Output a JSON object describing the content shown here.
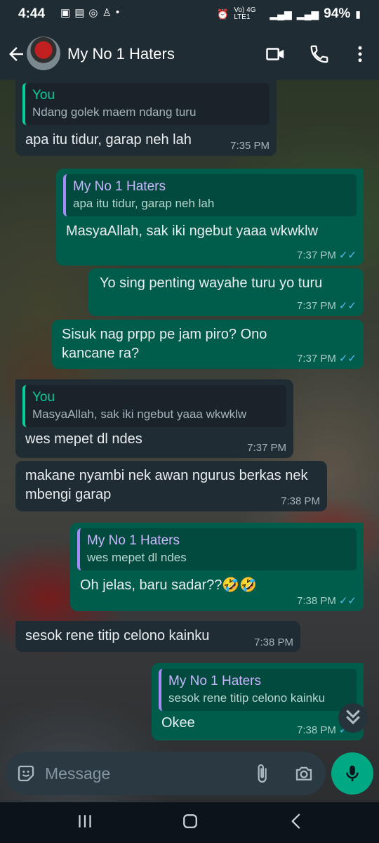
{
  "status_bar": {
    "time": "4:44",
    "network": "Vo) 4G LTE1",
    "battery": "94%"
  },
  "header": {
    "title": "My No 1 Haters"
  },
  "messages": [
    {
      "dir": "in",
      "quote_author": "You",
      "quote_text": "Ndang golek maem ndang turu",
      "text": "apa itu tidur, garap neh lah",
      "time": "7:35 PM"
    },
    {
      "dir": "out",
      "quote_author": "My No 1 Haters",
      "quote_text": "apa itu tidur, garap neh lah",
      "text": "MasyaAllah, sak iki ngebut yaaa wkwklw",
      "time": "7:37 PM"
    },
    {
      "dir": "out",
      "text": "Yo sing penting wayahe turu yo turu",
      "time": "7:37 PM"
    },
    {
      "dir": "out",
      "text": "Sisuk nag prpp pe jam piro? Ono kancane ra?",
      "time": "7:37 PM"
    },
    {
      "dir": "in",
      "quote_author": "You",
      "quote_text": "MasyaAllah, sak iki ngebut yaaa wkwklw",
      "text": "wes mepet dl ndes",
      "time": "7:37 PM"
    },
    {
      "dir": "in",
      "text": "makane nyambi nek awan ngurus berkas nek mbengi garap",
      "time": "7:38 PM"
    },
    {
      "dir": "out",
      "quote_author": "My No 1 Haters",
      "quote_text": "wes mepet dl ndes",
      "text": "Oh jelas, baru sadar??🤣🤣",
      "time": "7:38 PM"
    },
    {
      "dir": "in",
      "text": "sesok rene titip celono kainku",
      "time": "7:38 PM"
    },
    {
      "dir": "out",
      "quote_author": "My No 1 Haters",
      "quote_text": "sesok rene titip celono kainku",
      "text": "Okee",
      "time": "7:38 PM"
    }
  ],
  "composer": {
    "placeholder": "Message"
  },
  "colors": {
    "incoming_bubble": "#202c33",
    "outgoing_bubble": "#005c4b",
    "accent": "#00a884",
    "read_tick": "#53bdeb"
  }
}
